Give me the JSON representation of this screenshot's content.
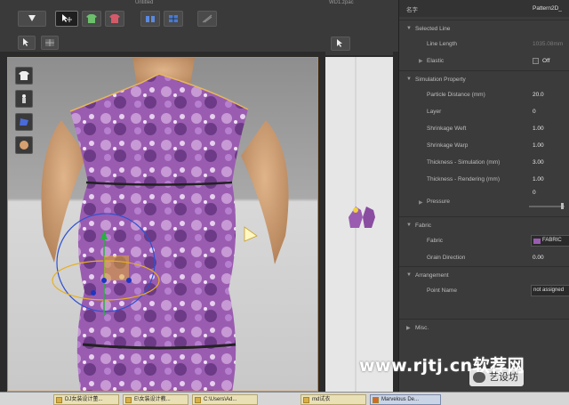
{
  "toolbar": {
    "tab_left": "Untitled",
    "tab_right": "WD1.zpac"
  },
  "panel": {
    "name_label": "名字",
    "name_value": "Pattern2D_",
    "sections": {
      "selected_line": "Selected Line",
      "simulation_property": "Simulation Property",
      "fabric": "Fabric",
      "arrangement": "Arrangement",
      "misc": "Misc."
    },
    "rows": {
      "line_length": {
        "label": "Line Length",
        "value": "1035.08mm"
      },
      "elastic": {
        "label": "Elastic",
        "value": "Off"
      },
      "particle_distance": {
        "label": "Particle Distance (mm)",
        "value": "20.0"
      },
      "layer": {
        "label": "Layer",
        "value": "0"
      },
      "shrinkage_weft": {
        "label": "Shrinkage Weft",
        "value": "1.00"
      },
      "shrinkage_warp": {
        "label": "Shrinkage Warp",
        "value": "1.00"
      },
      "thickness_sim": {
        "label": "Thickness - Simulation (mm)",
        "value": "3.00"
      },
      "thickness_render": {
        "label": "Thickness - Rendering (mm)",
        "value": "1.00"
      },
      "pressure": {
        "label": "Pressure",
        "value": "0"
      },
      "fabric": {
        "label": "Fabric",
        "value": "FABRIC"
      },
      "grain_direction": {
        "label": "Grain Direction",
        "value": "0.00"
      },
      "point_name": {
        "label": "Point Name",
        "value": "not assigned"
      }
    },
    "pressure_slider_level": 0.95
  },
  "taskbar": {
    "items": [
      "DJ女装设计董...",
      "E\\女装设计教...",
      "C:\\Users\\Ad...",
      "md试衣",
      "Marvelous De..."
    ]
  },
  "watermark": {
    "url": "www.rjtj.cn软荐网",
    "badge": "艺设坊"
  },
  "colors": {
    "panel_bg": "#3b3b3b",
    "viewport_border": "#d08a3a",
    "dress_purple": "#9a5cb0"
  }
}
